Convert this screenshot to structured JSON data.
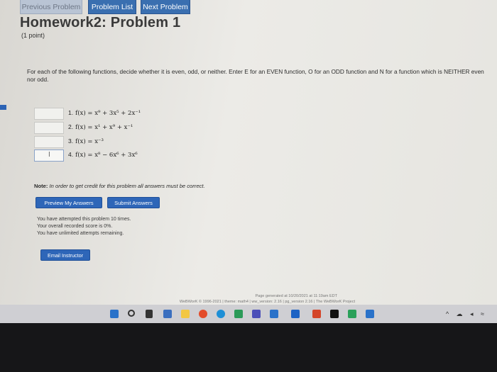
{
  "nav": {
    "previous_label": "Previous Problem",
    "list_label": "Problem List",
    "next_label": "Next Problem"
  },
  "header": {
    "title": "Homework2: Problem 1",
    "points": "(1 point)"
  },
  "instructions": "For each of the following functions, decide whether it is even, odd, or neither. Enter E for an EVEN function, O for an ODD function and N for a function which is NEITHER even nor odd.",
  "questions": [
    {
      "number": "1.",
      "formula": "f(x) = x⁹ + 3x⁵ + 2x⁻¹",
      "answer": ""
    },
    {
      "number": "2.",
      "formula": "f(x) = x¹ + x⁹ + x⁻¹",
      "answer": ""
    },
    {
      "number": "3.",
      "formula": "f(x) = x⁻³",
      "answer": ""
    },
    {
      "number": "4.",
      "formula": "f(x) = x⁸ − 6x⁶ + 3x⁶",
      "answer": ""
    }
  ],
  "note": {
    "label": "Note:",
    "text": "In order to get credit for this problem all answers must be correct."
  },
  "buttons": {
    "preview": "Preview My Answers",
    "submit": "Submit Answers",
    "email": "Email Instructor"
  },
  "status": {
    "attempts": "You have attempted this problem 10 times.",
    "score": "Your overall recorded score is 0%.",
    "remaining": "You have unlimited attempts remaining."
  },
  "footer": {
    "generated": "Page generated at 10/20/2021 at 11:19am EDT",
    "copyright": "WeBWorK © 1996-2021 | theme: math4 | ww_version: 2.16 | pg_version 2.16 | The WeBWorK Project"
  },
  "colors": {
    "button_blue": "#2e66b8",
    "background": "#e6e5e0"
  }
}
